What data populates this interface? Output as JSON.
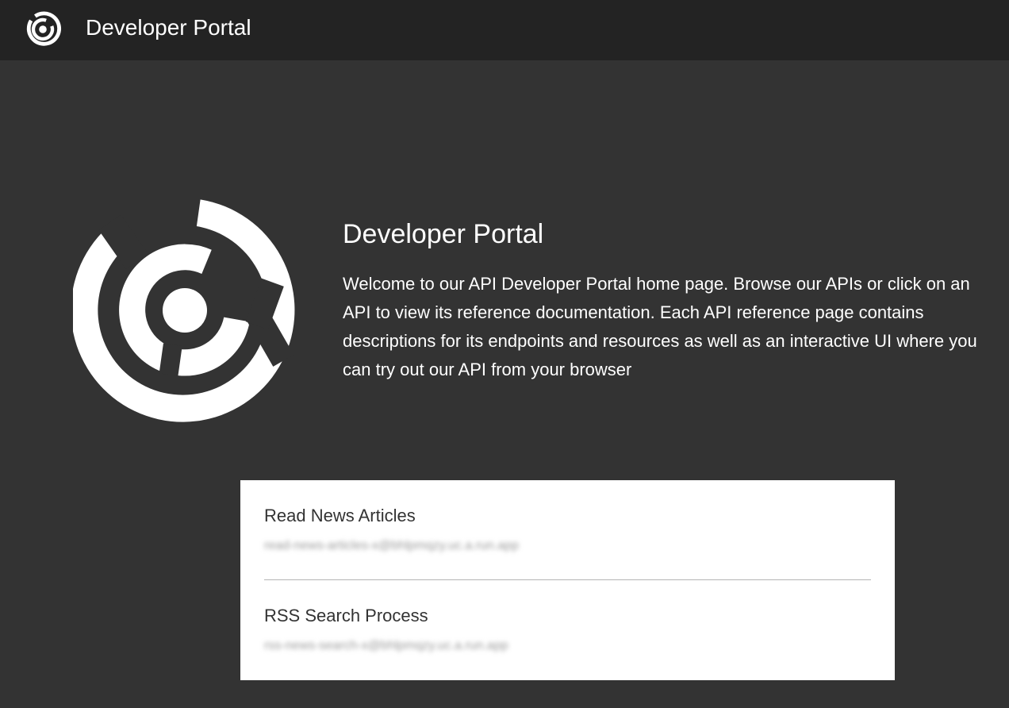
{
  "header": {
    "title": "Developer Portal",
    "logo_icon": "portal-logo-icon"
  },
  "hero": {
    "logo_icon": "portal-logo-icon",
    "title": "Developer Portal",
    "description": "Welcome to our API Developer Portal home page. Browse our APIs or click on an API to view its reference documentation. Each API reference page contains descriptions for its endpoints and resources as well as an interactive UI where you can try out our API from your browser"
  },
  "apis": [
    {
      "name": "Read News Articles",
      "email": "read-news-articles-x@bhlpmqzy.uc.a.run.app"
    },
    {
      "name": "RSS Search Process",
      "email": "rss-news-search-x@bhlpmqzy.uc.a.run.app"
    }
  ],
  "colors": {
    "background": "#333333",
    "topbar": "#232323",
    "card": "#ffffff",
    "text_light": "#ffffff",
    "text_dark": "#333333"
  }
}
